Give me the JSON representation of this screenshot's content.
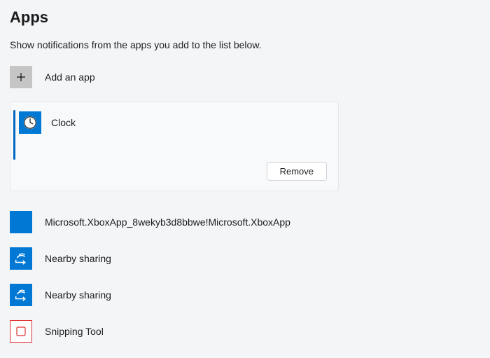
{
  "title": "Apps",
  "subtitle": "Show notifications from the apps you add to the list below.",
  "add": {
    "label": "Add an app"
  },
  "selected": {
    "icon": "clock-icon",
    "label": "Clock",
    "remove_label": "Remove"
  },
  "apps": [
    {
      "icon": "xbox-icon",
      "label": "Microsoft.XboxApp_8wekyb3d8bbwe!Microsoft.XboxApp"
    },
    {
      "icon": "share-icon",
      "label": "Nearby sharing"
    },
    {
      "icon": "share-icon",
      "label": "Nearby sharing"
    },
    {
      "icon": "snip-icon",
      "label": "Snipping Tool"
    }
  ],
  "colors": {
    "accent": "#0078d4"
  }
}
